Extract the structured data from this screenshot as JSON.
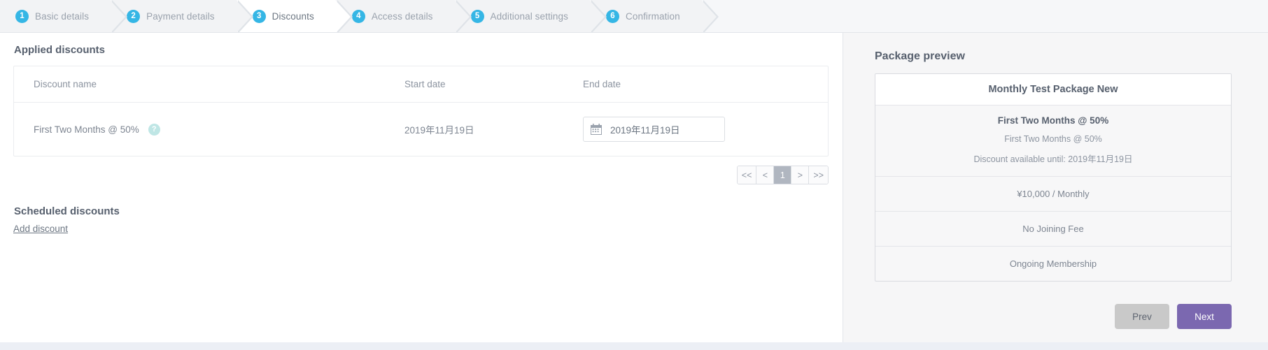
{
  "steps": [
    {
      "num": "1",
      "label": "Basic details",
      "active": false
    },
    {
      "num": "2",
      "label": "Payment details",
      "active": false
    },
    {
      "num": "3",
      "label": "Discounts",
      "active": true
    },
    {
      "num": "4",
      "label": "Access details",
      "active": false
    },
    {
      "num": "5",
      "label": "Additional settings",
      "active": false
    },
    {
      "num": "6",
      "label": "Confirmation",
      "active": false
    }
  ],
  "main": {
    "applied_title": "Applied discounts",
    "table": {
      "headers": [
        "Discount name",
        "Start date",
        "End date"
      ],
      "rows": [
        {
          "discount_name": "First Two Months @ 50%",
          "help_icon": "question-mark-icon",
          "help_glyph": "?",
          "start_date": "2019年11月19日",
          "end_date": "2019年11月19日",
          "end_date_icon": "calendar-icon"
        }
      ]
    },
    "pagination": {
      "first": "<<",
      "prev": "<",
      "current": "1",
      "next": ">",
      "last": ">>"
    },
    "scheduled_title": "Scheduled discounts",
    "add_discount_link": "Add discount"
  },
  "preview": {
    "title": "Package preview",
    "package_name": "Monthly Test Package New",
    "discount": {
      "title": "First Two Months @ 50%",
      "subtitle": "First Two Months @ 50%",
      "availability": "Discount available until: 2019年11月19日"
    },
    "rows": [
      "¥10,000 / Monthly",
      "No Joining Fee",
      "Ongoing Membership"
    ]
  },
  "footer": {
    "prev_label": "Prev",
    "next_label": "Next"
  },
  "colors": {
    "step_accent": "#35b6e5",
    "next_button": "#7b68b0",
    "prev_button": "#c9c9c9",
    "help_icon": "#bfe6e5",
    "pagination_active": "#b0b6c0"
  }
}
